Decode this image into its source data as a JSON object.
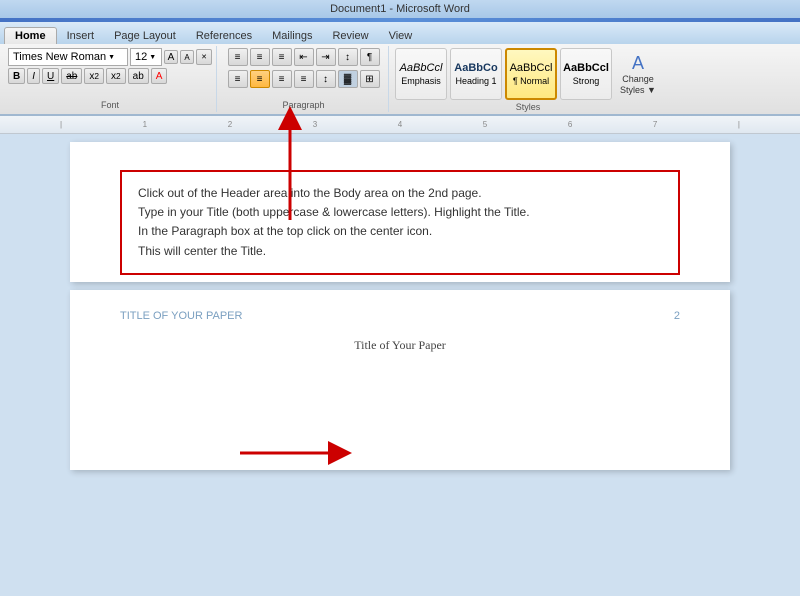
{
  "titlebar": {
    "text": "Document1 - Microsoft Word"
  },
  "tabs": [
    {
      "label": "Home",
      "active": true
    },
    {
      "label": "Insert",
      "active": false
    },
    {
      "label": "Page Layout",
      "active": false
    },
    {
      "label": "References",
      "active": false
    },
    {
      "label": "Mailings",
      "active": false
    },
    {
      "label": "Review",
      "active": false
    },
    {
      "label": "View",
      "active": false
    }
  ],
  "font": {
    "name": "Times New Roman",
    "size": "12",
    "bold": "B",
    "italic": "I",
    "underline": "U",
    "strikethrough": "ab",
    "subscript": "x₂",
    "superscript": "x²",
    "group_label": "Font"
  },
  "paragraph": {
    "group_label": "Paragraph",
    "buttons": [
      "≡",
      "≡",
      "≡",
      "≡",
      "¶"
    ]
  },
  "styles": {
    "group_label": "Styles",
    "items": [
      {
        "label": "Emphasis",
        "sample": "AaBbCcl",
        "class": "emphasis"
      },
      {
        "label": "Heading 1",
        "sample": "AaBbCo",
        "class": "heading1"
      },
      {
        "label": "¶ Normal",
        "sample": "AaBbCcl",
        "class": "normal",
        "highlighted": true
      },
      {
        "label": "Strong",
        "sample": "AaBbCcl",
        "class": "strong"
      }
    ],
    "change_styles": "Change\nStyles"
  },
  "instruction": {
    "line1": "Click out of the Header area into the Body area on the 2nd page.",
    "line2": "Type in your Title (both uppercase & lowercase letters). Highlight the Title.",
    "line3": "In the Paragraph box at the top click on the center icon.",
    "line4": "This will center the Title."
  },
  "page2": {
    "header_left": "TITLE OF YOUR PAPER",
    "header_right": "2",
    "body_text": "Title of Your Paper"
  },
  "ruler": {
    "marks": [
      "1",
      "2",
      "3",
      "4",
      "5",
      "6",
      "7"
    ]
  }
}
